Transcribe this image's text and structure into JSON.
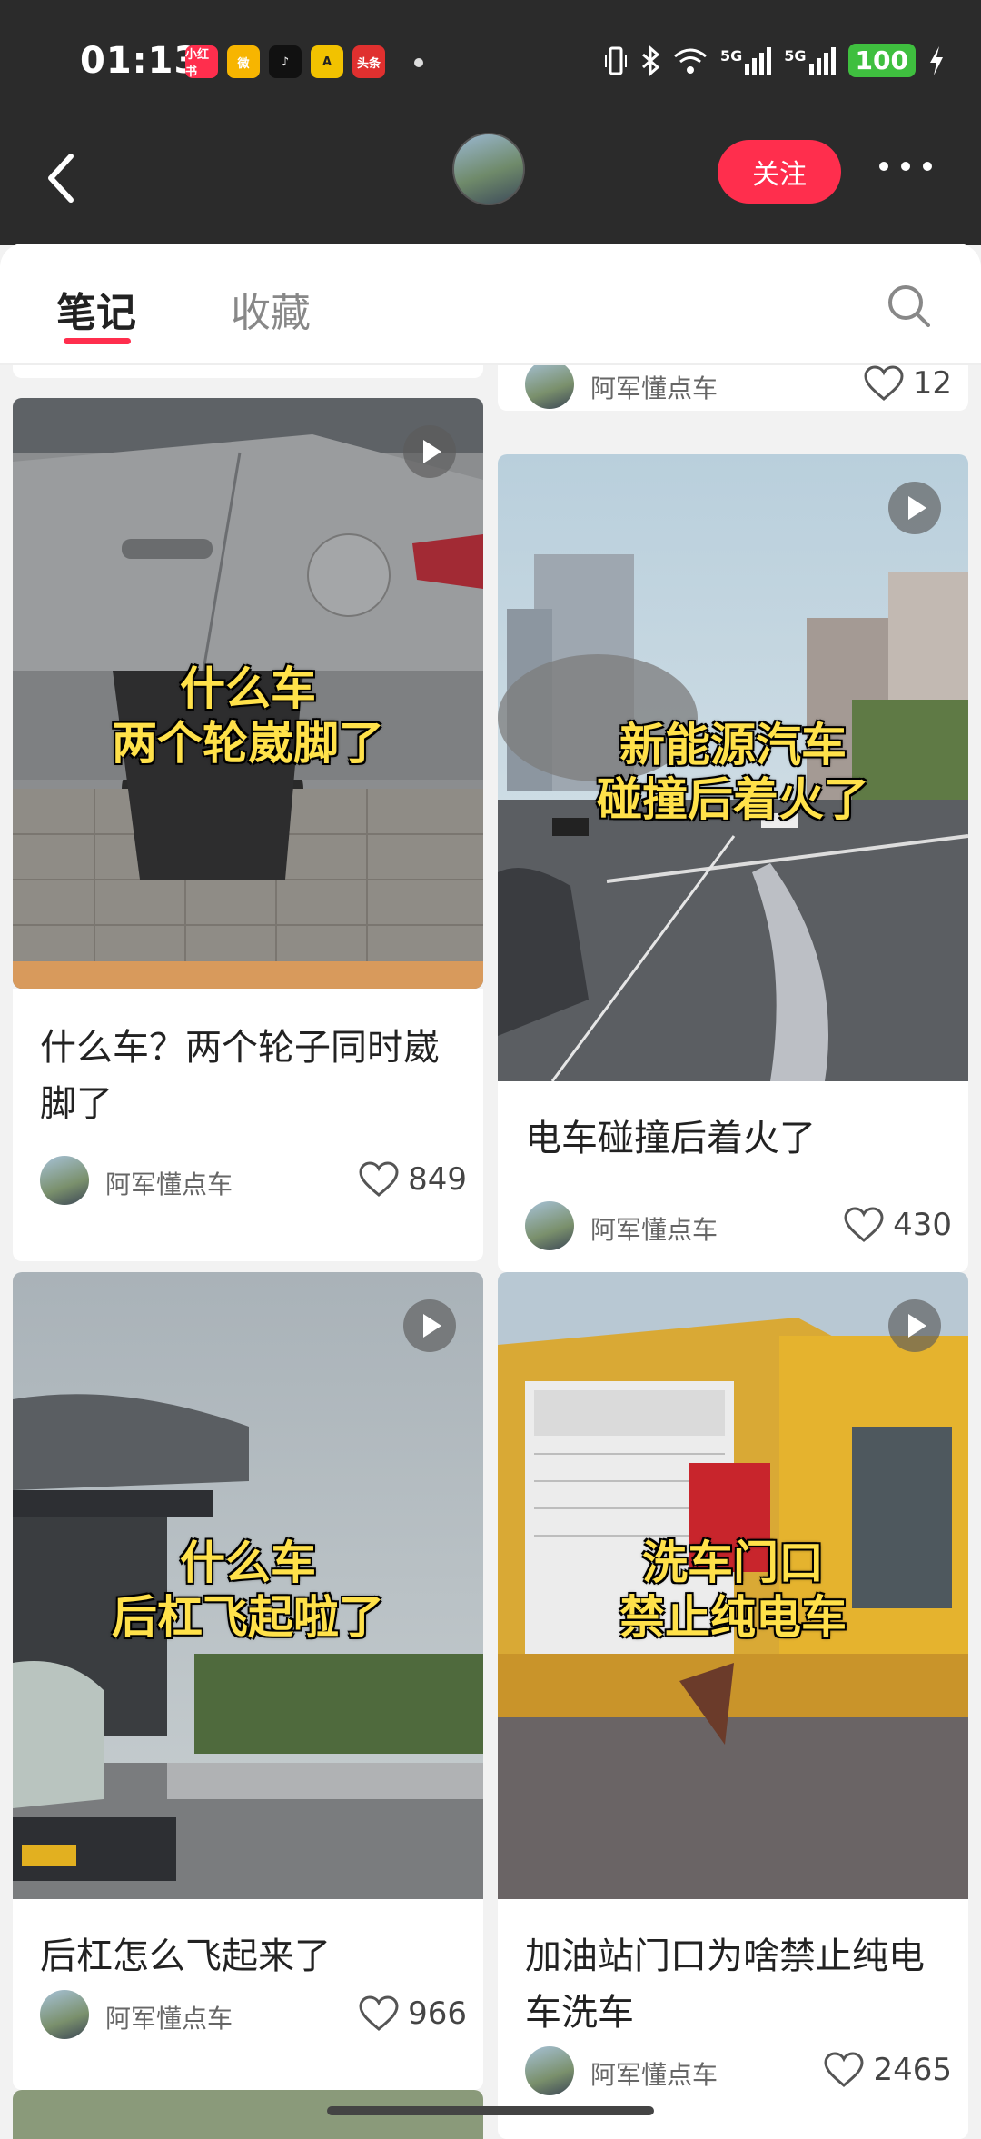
{
  "status_bar": {
    "time": "01:13",
    "apps": [
      {
        "icon": "xiaohongshu-icon",
        "label": "小红书",
        "color": "#ff2e4d"
      },
      {
        "icon": "weibo-icon",
        "label": "微",
        "color": "#f7b500"
      },
      {
        "icon": "tiktok-icon",
        "label": "♪",
        "color": "#111111"
      },
      {
        "icon": "app-a-icon",
        "label": "A",
        "color": "#f2c200"
      },
      {
        "icon": "toutiao-icon",
        "label": "头条",
        "color": "#e0302f"
      }
    ],
    "network_1": "5G",
    "network_2": "5G",
    "battery": "100"
  },
  "header": {
    "follow_label": "关注"
  },
  "tabs": {
    "notes": "笔记",
    "favorites": "收藏"
  },
  "top_partial": {
    "author": "阿军懂点车",
    "likes": "12"
  },
  "cards": [
    {
      "caption_line1": "什么车",
      "caption_line2": "两个轮崴脚了",
      "title": "什么车？两个轮子同时崴脚了",
      "author": "阿军懂点车",
      "likes": "849"
    },
    {
      "caption_line1": "新能源汽车",
      "caption_line2": "碰撞后着火了",
      "title": "电车碰撞后着火了",
      "author": "阿军懂点车",
      "likes": "430"
    },
    {
      "caption_line1": "什么车",
      "caption_line2": "后杠飞起啦了",
      "title": "后杠怎么飞起来了",
      "author": "阿军懂点车",
      "likes": "966"
    },
    {
      "caption_line1": "洗车门口",
      "caption_line2": "禁止纯电车",
      "title": "加油站门口为啥禁止纯电车洗车",
      "author": "阿军懂点车",
      "likes": "2465"
    }
  ]
}
